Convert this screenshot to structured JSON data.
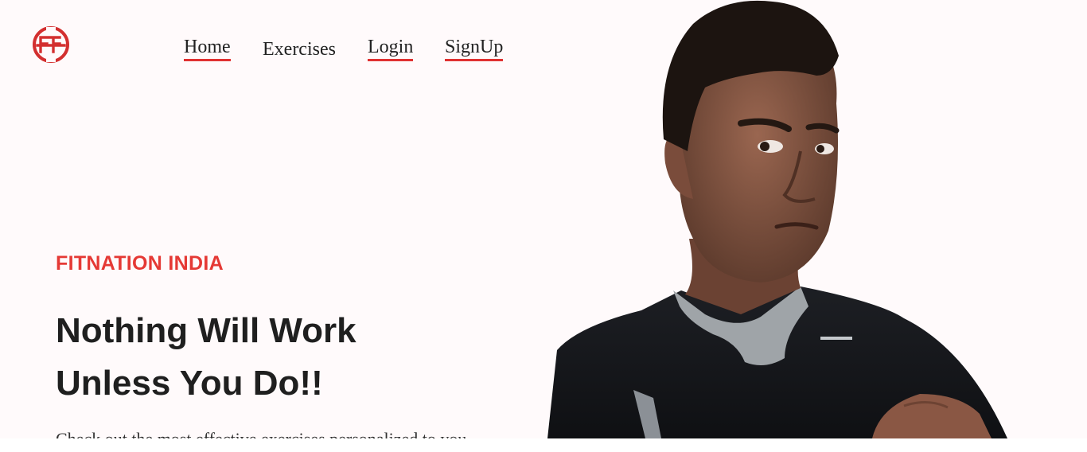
{
  "header": {
    "logo_icon": "fitnation-logo-icon",
    "nav": [
      {
        "id": "home",
        "label": "Home"
      },
      {
        "id": "exercises",
        "label": "Exercises"
      },
      {
        "id": "login",
        "label": "Login"
      },
      {
        "id": "signup",
        "label": "SignUp"
      }
    ]
  },
  "hero": {
    "brand": "FITNATION INDIA",
    "headline_line1": "Nothing Will Work",
    "headline_line2": "Unless You Do!!",
    "tagline": "Check out the most effective exercises personalized to you"
  },
  "colors": {
    "accent": "#e53935",
    "background": "#fffafb",
    "text": "#1f1f1f"
  }
}
